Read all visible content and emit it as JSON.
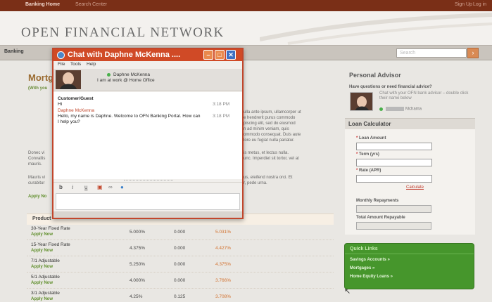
{
  "topbar": {
    "left_links": [
      "Banking Home",
      "Search Center"
    ],
    "right_links": [
      "Sign Up",
      "Log in"
    ]
  },
  "header": {
    "logo": "OPEN FINANCIAL NETWORK"
  },
  "nav": {
    "tab": "Banking",
    "search_placeholder": "Search"
  },
  "main": {
    "title": "Mortg",
    "subtitle": "(With you",
    "para1_right": [
      "ulla ante ipsum, ullamcorper ut",
      "e hendrerit purus commodo",
      "piscing elit, sed do eiusmod",
      "n ad minim veniam, quis",
      "ommodo consequat. Duis aute",
      "lore eu fugiat nulla pariatur."
    ],
    "para2_left": [
      "Donec vi",
      "Convallis",
      "mauris."
    ],
    "para2_right": [
      "is metus, et lectus nulla.",
      "unc. Imperdiet sit tortor, vel at"
    ],
    "para3_left": [
      "Mauris vi",
      "curabitur"
    ],
    "para3_right": [
      "us, eleifend nostra orci. Et",
      "r, pede urna."
    ],
    "apply_partial": "Apply No"
  },
  "rates": {
    "header_label": "Product",
    "rows": [
      {
        "name": "30-Year Fixed Rate",
        "apply": "Apply Now",
        "rate": "5.000%",
        "points": "0.000",
        "apr": "5.031%"
      },
      {
        "name": "15-Year Fixed Rate",
        "apply": "Apply Now",
        "rate": "4.375%",
        "points": "0.000",
        "apr": "4.427%"
      },
      {
        "name": "7/1 Adjustable",
        "apply": "Apply Now",
        "rate": "5.250%",
        "points": "0.000",
        "apr": "4.375%"
      },
      {
        "name": "5/1 Adjustable",
        "apply": "Apply Now",
        "rate": "4.000%",
        "points": "0.000",
        "apr": "3.766%"
      },
      {
        "name": "3/1 Adjustable",
        "apply": "Apply Now",
        "rate": "4.25%",
        "points": "0.125",
        "apr": "3.708%"
      }
    ]
  },
  "advisor": {
    "title": "Personal Advisor",
    "question": "Have questions or need financial advice?",
    "description": "Chat with your OFN bank advisor – double click their name below",
    "status_name": "Mchama"
  },
  "calculator": {
    "title": "Loan Calculator",
    "required_marker": "*",
    "fields": [
      "Loan Amount",
      "Term (yrs)",
      "Rate (APR)"
    ],
    "calculate": "Calculate",
    "results": [
      "Monthly Repayments",
      "Total Amount Repayable"
    ]
  },
  "quick_links": {
    "title": "Quick Links",
    "items": [
      "Savings Accounts »",
      "Mortgages »",
      "Home Equity Loans »"
    ]
  },
  "chat": {
    "title": "Chat with Daphne McKenna ....",
    "menu": [
      "File",
      "Tools",
      "Help"
    ],
    "contact_name": "Daphne McKenna",
    "contact_status": "I am at work @ Home Office",
    "messages": [
      {
        "sender": "Customer/Guest",
        "text": "Hi",
        "time": "3:18 PM"
      },
      {
        "sender": "Daphne McKenna",
        "text": "Hello, my name is Daphne. Welcome to OFN Banking Portal. How can I help you?",
        "time": "3:18 PM"
      }
    ],
    "toolbar": [
      "b",
      "i",
      "u"
    ]
  },
  "colors": {
    "accent": "#d04a26",
    "brand_bar": "#7a2f17",
    "link_green": "#5f8e2b",
    "quick_links_bg": "#46962c"
  }
}
